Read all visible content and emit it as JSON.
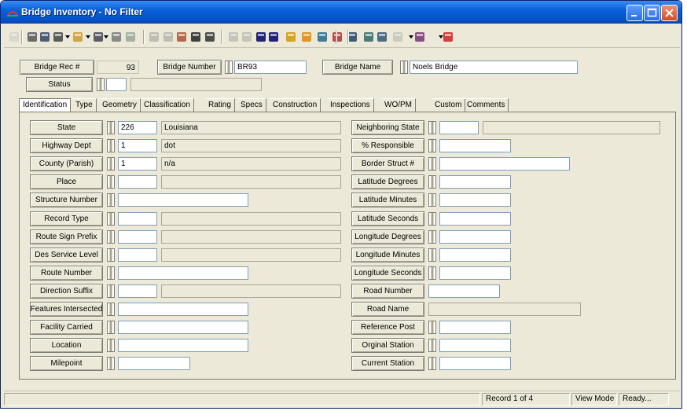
{
  "window": {
    "title": "Bridge Inventory - No Filter"
  },
  "header": {
    "bridge_rec_label": "Bridge Rec #",
    "bridge_rec_value": "93",
    "bridge_number_label": "Bridge Number",
    "bridge_number_value": "BR93",
    "bridge_name_label": "Bridge Name",
    "bridge_name_value": "Noels Bridge",
    "status_label": "Status",
    "status_code": "",
    "status_desc": ""
  },
  "tabs": [
    "Identification",
    "Type",
    "Geometry",
    "Classification",
    "Rating",
    "Specs",
    "Construction",
    "Inspections",
    "WO/PM",
    "Custom",
    "Comments"
  ],
  "active_tab": "Identification",
  "left_fields": [
    {
      "label": "State",
      "code": "226",
      "desc": "Louisiana"
    },
    {
      "label": "Highway Dept",
      "code": "1",
      "desc": "dot"
    },
    {
      "label": "County (Parish)",
      "code": "1",
      "desc": "n/a"
    },
    {
      "label": "Place",
      "code": "",
      "desc": ""
    },
    {
      "label": "Structure Number",
      "value": ""
    },
    {
      "label": "Record Type",
      "code": "",
      "desc": ""
    },
    {
      "label": "Route Sign Prefix",
      "code": "",
      "desc": ""
    },
    {
      "label": "Des Service Level",
      "code": "",
      "desc": ""
    },
    {
      "label": "Route Number",
      "value": ""
    },
    {
      "label": "Direction Suffix",
      "code": "",
      "desc": ""
    },
    {
      "label": "Features Intersected",
      "value": ""
    },
    {
      "label": "Facility Carried",
      "value": ""
    },
    {
      "label": "Location",
      "value": ""
    },
    {
      "label": "Milepoint",
      "value": ""
    }
  ],
  "right_fields": [
    {
      "label": "Neighboring State",
      "code": "",
      "desc": ""
    },
    {
      "label": "% Responsible",
      "value": ""
    },
    {
      "label": "Border Struct #",
      "value": ""
    },
    {
      "label": "Latitude Degrees",
      "value": ""
    },
    {
      "label": "Latitude Minutes",
      "value": ""
    },
    {
      "label": "Latitude Seconds",
      "value": ""
    },
    {
      "label": "Longitude Degrees",
      "value": ""
    },
    {
      "label": "Longitude Minutes",
      "value": ""
    },
    {
      "label": "Longitude Seconds",
      "value": ""
    },
    {
      "label": "Road Number",
      "value": ""
    },
    {
      "label": "Road Name",
      "value": ""
    },
    {
      "label": "Reference Post",
      "value": ""
    },
    {
      "label": "Orginal Station",
      "value": ""
    },
    {
      "label": "Current Station",
      "value": ""
    }
  ],
  "status_bar": {
    "record": "Record 1 of 4",
    "mode": "View Mode",
    "state": "Ready..."
  },
  "toolbar_icons": [
    "new-icon",
    "print-icon",
    "print-preview-icon",
    "find-icon",
    "filter-icon",
    "view-icon",
    "copy-record-icon",
    "open-icon",
    "save-icon",
    "delete-icon",
    "attach-icon",
    "edit-icon",
    "cut-icon",
    "first-record-icon",
    "previous-record-icon",
    "next-record-icon",
    "last-record-icon",
    "goto-icon",
    "run-icon",
    "report-icon",
    "link-icon",
    "chart-icon",
    "calendar-icon",
    "map-icon",
    "globe-icon",
    "tools-icon",
    "exit-icon"
  ]
}
